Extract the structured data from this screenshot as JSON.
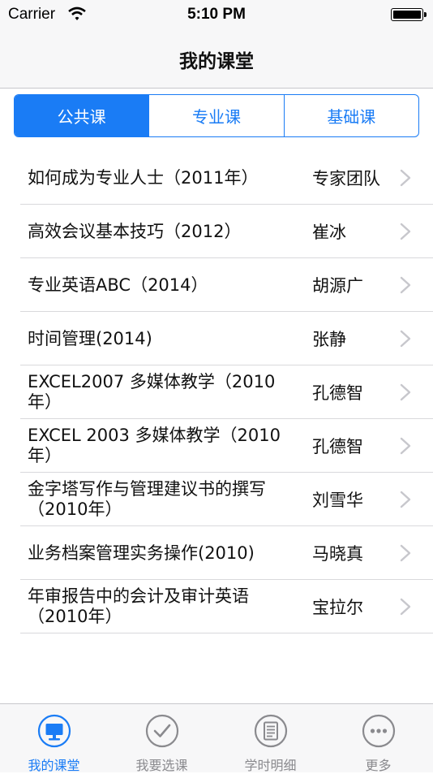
{
  "status_bar": {
    "carrier": "Carrier",
    "time": "5:10 PM"
  },
  "nav": {
    "title": "我的课堂"
  },
  "segments": [
    "公共课",
    "专业课",
    "基础课"
  ],
  "selected_segment": "公共课",
  "courses": [
    {
      "title": "如何成为专业人士（2011年）",
      "teacher": "专家团队"
    },
    {
      "title": "高效会议基本技巧（2012）",
      "teacher": "崔冰"
    },
    {
      "title": "专业英语ABC（2014）",
      "teacher": "胡源广"
    },
    {
      "title": "时间管理(2014)",
      "teacher": "张静"
    },
    {
      "title": "EXCEL2007 多媒体教学（2010年）",
      "teacher": "孔德智"
    },
    {
      "title": "EXCEL 2003 多媒体教学（2010年）",
      "teacher": "孔德智"
    },
    {
      "title": "金字塔写作与管理建议书的撰写 （2010年）",
      "teacher": "刘雪华"
    },
    {
      "title": "业务档案管理实务操作(2010)",
      "teacher": "马晓真"
    },
    {
      "title": "年审报告中的会计及审计英语 （2010年）",
      "teacher": "宝拉尔"
    }
  ],
  "tabs": [
    {
      "label": "我的课堂",
      "icon": "monitor-icon"
    },
    {
      "label": "我要选课",
      "icon": "checkmark-circle-icon"
    },
    {
      "label": "学时明细",
      "icon": "document-list-icon"
    },
    {
      "label": "更多",
      "icon": "more-dots-icon"
    }
  ],
  "colors": {
    "accent": "#1a7cf5",
    "inactive": "#8a8a8e",
    "bar": "#f7f7f8"
  }
}
